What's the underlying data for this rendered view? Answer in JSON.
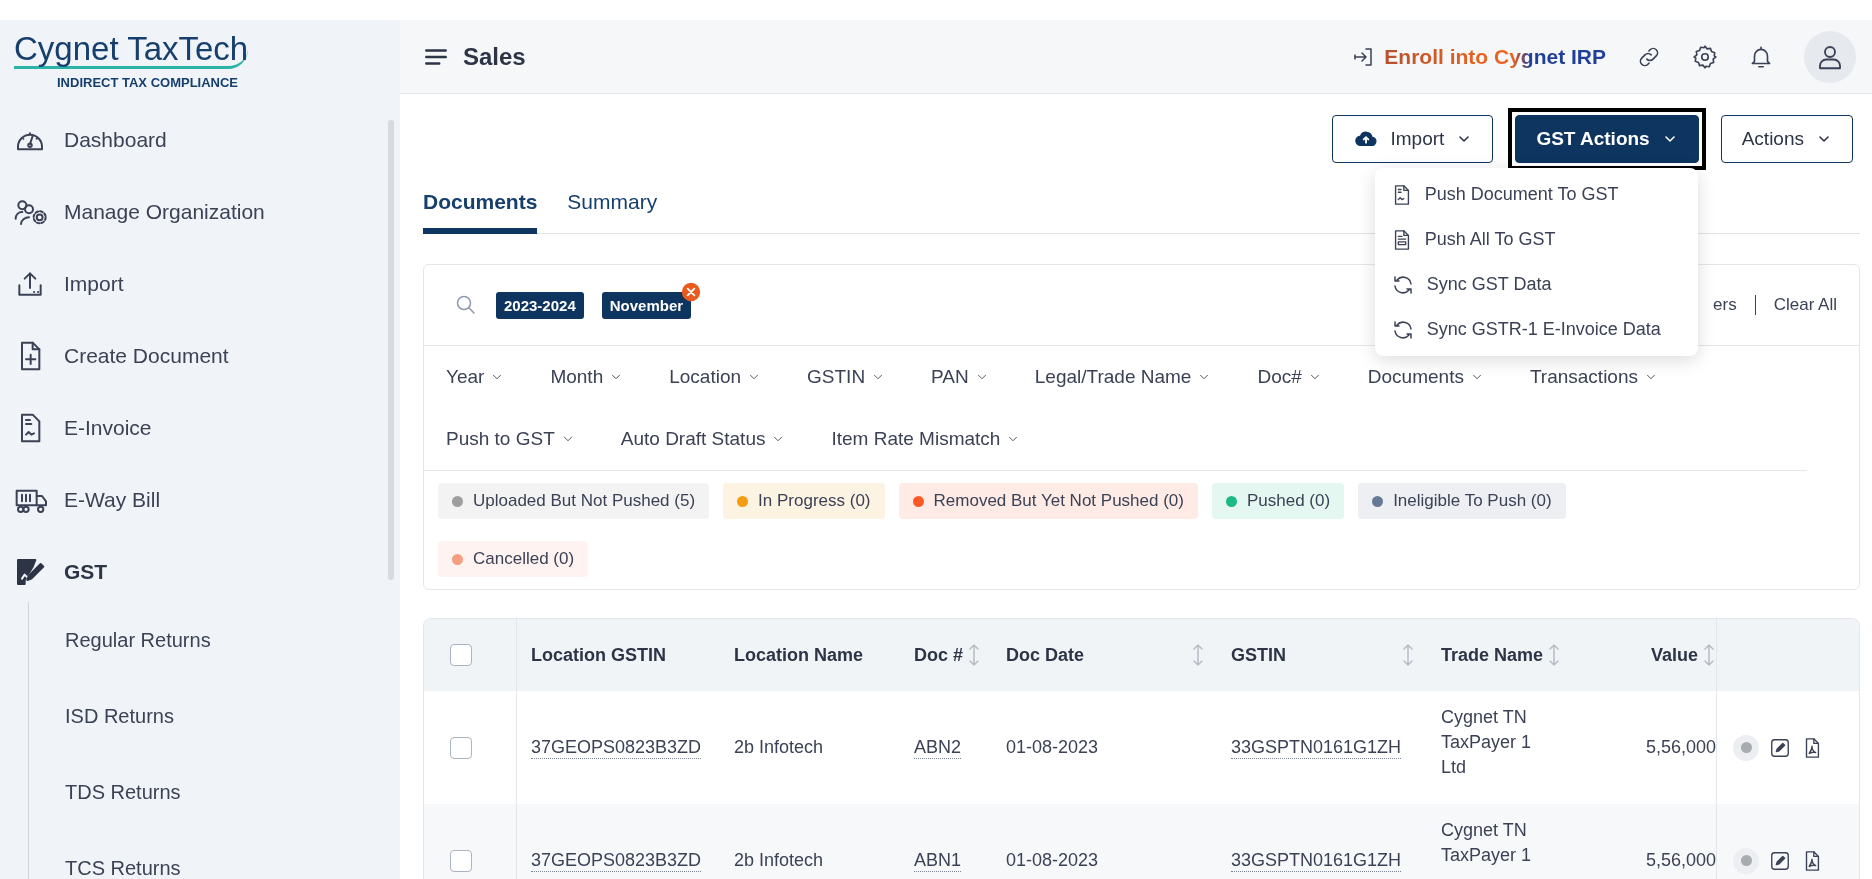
{
  "logo": {
    "brand": "Cygnet TaxTech",
    "tagline": "INDIRECT TAX COMPLIANCE"
  },
  "sidebar": {
    "items": [
      {
        "label": "Dashboard",
        "selected": false
      },
      {
        "label": "Manage Organization",
        "selected": false
      },
      {
        "label": "Import",
        "selected": false
      },
      {
        "label": "Create Document",
        "selected": false
      },
      {
        "label": "E-Invoice",
        "selected": false
      },
      {
        "label": "E-Way Bill",
        "selected": false
      },
      {
        "label": "GST",
        "selected": true,
        "expanded": true,
        "children": [
          {
            "label": "Regular Returns"
          },
          {
            "label": "ISD Returns"
          },
          {
            "label": "TDS Returns"
          },
          {
            "label": "TCS Returns"
          }
        ]
      }
    ]
  },
  "header": {
    "title": "Sales",
    "enroll": "Enroll into Cygnet IRP"
  },
  "toolbar": {
    "buttons": [
      {
        "label": "Import",
        "kind": "outline",
        "focused": false
      },
      {
        "label": "GST Actions",
        "kind": "primary",
        "focused": true,
        "menu": [
          {
            "label": "Push Document To GST"
          },
          {
            "label": "Push All To GST"
          },
          {
            "label": "Sync GST Data"
          },
          {
            "label": "Sync GSTR-1 E-Invoice Data"
          }
        ]
      },
      {
        "label": "Actions",
        "kind": "outline",
        "focused": false
      }
    ]
  },
  "tabs": [
    {
      "label": "Documents",
      "selected": true
    },
    {
      "label": "Summary",
      "selected": false
    }
  ],
  "filters": {
    "chips": [
      {
        "label": "2023-2024",
        "removable": false
      },
      {
        "label": "November",
        "removable": true
      }
    ],
    "clear_filters_visible_part": "ers",
    "clear_all": "Clear All",
    "dropdowns": [
      "Year",
      "Month",
      "Location",
      "GSTIN",
      "PAN",
      "Legal/Trade Name",
      "Doc#",
      "Documents",
      "Transactions",
      "Push to GST",
      "Auto Draft Status",
      "Item Rate Mismatch"
    ],
    "statuses": [
      {
        "label": "Uploaded But Not Pushed (5)",
        "color": "#9e9e9e"
      },
      {
        "label": "In Progress (0)",
        "color": "#f29d12"
      },
      {
        "label": "Removed But Yet Not Pushed (0)",
        "color": "#fb5a28"
      },
      {
        "label": "Pushed (0)",
        "color": "#1db987"
      },
      {
        "label": "Ineligible To Push (0)",
        "color": "#677a95"
      },
      {
        "label": "Cancelled (0)",
        "color": "#f59e82"
      }
    ]
  },
  "table": {
    "header_checked": false,
    "columns": [
      {
        "label": "Location GSTIN",
        "sortable": false,
        "kind": "link"
      },
      {
        "label": "Location Name",
        "sortable": false,
        "kind": "text"
      },
      {
        "label": "Doc #",
        "sortable": true,
        "kind": "link"
      },
      {
        "label": "Doc Date",
        "sortable": true,
        "kind": "text"
      },
      {
        "label": "GSTIN",
        "sortable": true,
        "kind": "link"
      },
      {
        "label": "Trade Name",
        "sortable": true,
        "kind": "text"
      },
      {
        "label": "Value",
        "sortable": true,
        "kind": "number"
      }
    ],
    "rows": [
      {
        "checked": false,
        "cells": [
          "37GEOPS0823B3ZD",
          "2b Infotech",
          "ABN2",
          "01-08-2023",
          "33GSPTN0161G1ZH",
          "Cygnet TN TaxPayer 1 Ltd",
          "5,56,000"
        ]
      },
      {
        "checked": false,
        "cells": [
          "37GEOPS0823B3ZD",
          "2b Infotech",
          "ABN1",
          "01-08-2023",
          "33GSPTN0161G1ZH",
          "Cygnet TN TaxPayer 1",
          "5,56,000"
        ]
      }
    ]
  }
}
